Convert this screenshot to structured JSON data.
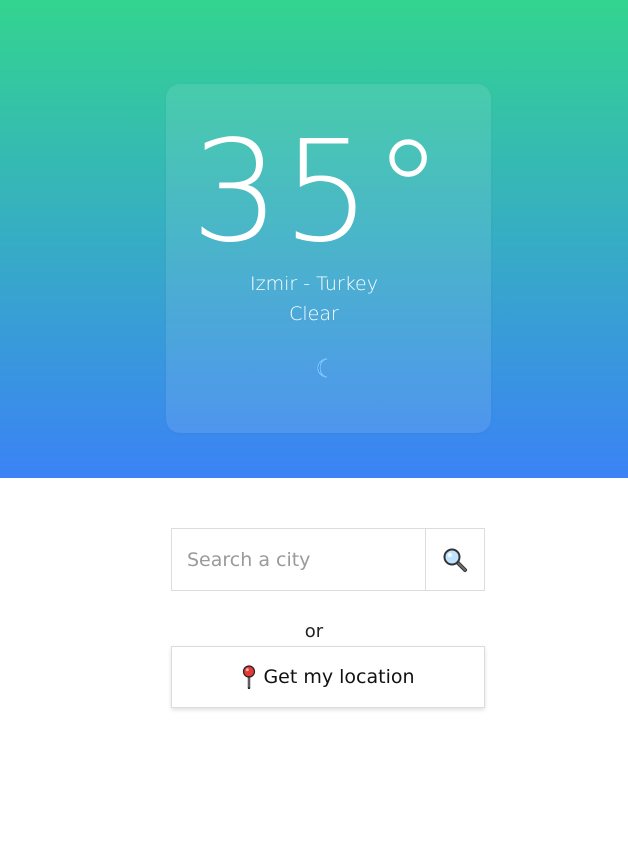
{
  "weather": {
    "temperature": "35°",
    "location": "Izmir - Turkey",
    "condition": "Clear",
    "condition_icon": "moon-icon"
  },
  "search": {
    "placeholder": "Search a city",
    "value": "",
    "button_icon": "search-icon"
  },
  "separator_text": "or",
  "location_button": {
    "label": "Get my location",
    "icon": "pin-icon"
  },
  "colors": {
    "gradient_top": "#33d48f",
    "gradient_bottom": "#3b82f6",
    "moon": "#1a6ed8"
  }
}
